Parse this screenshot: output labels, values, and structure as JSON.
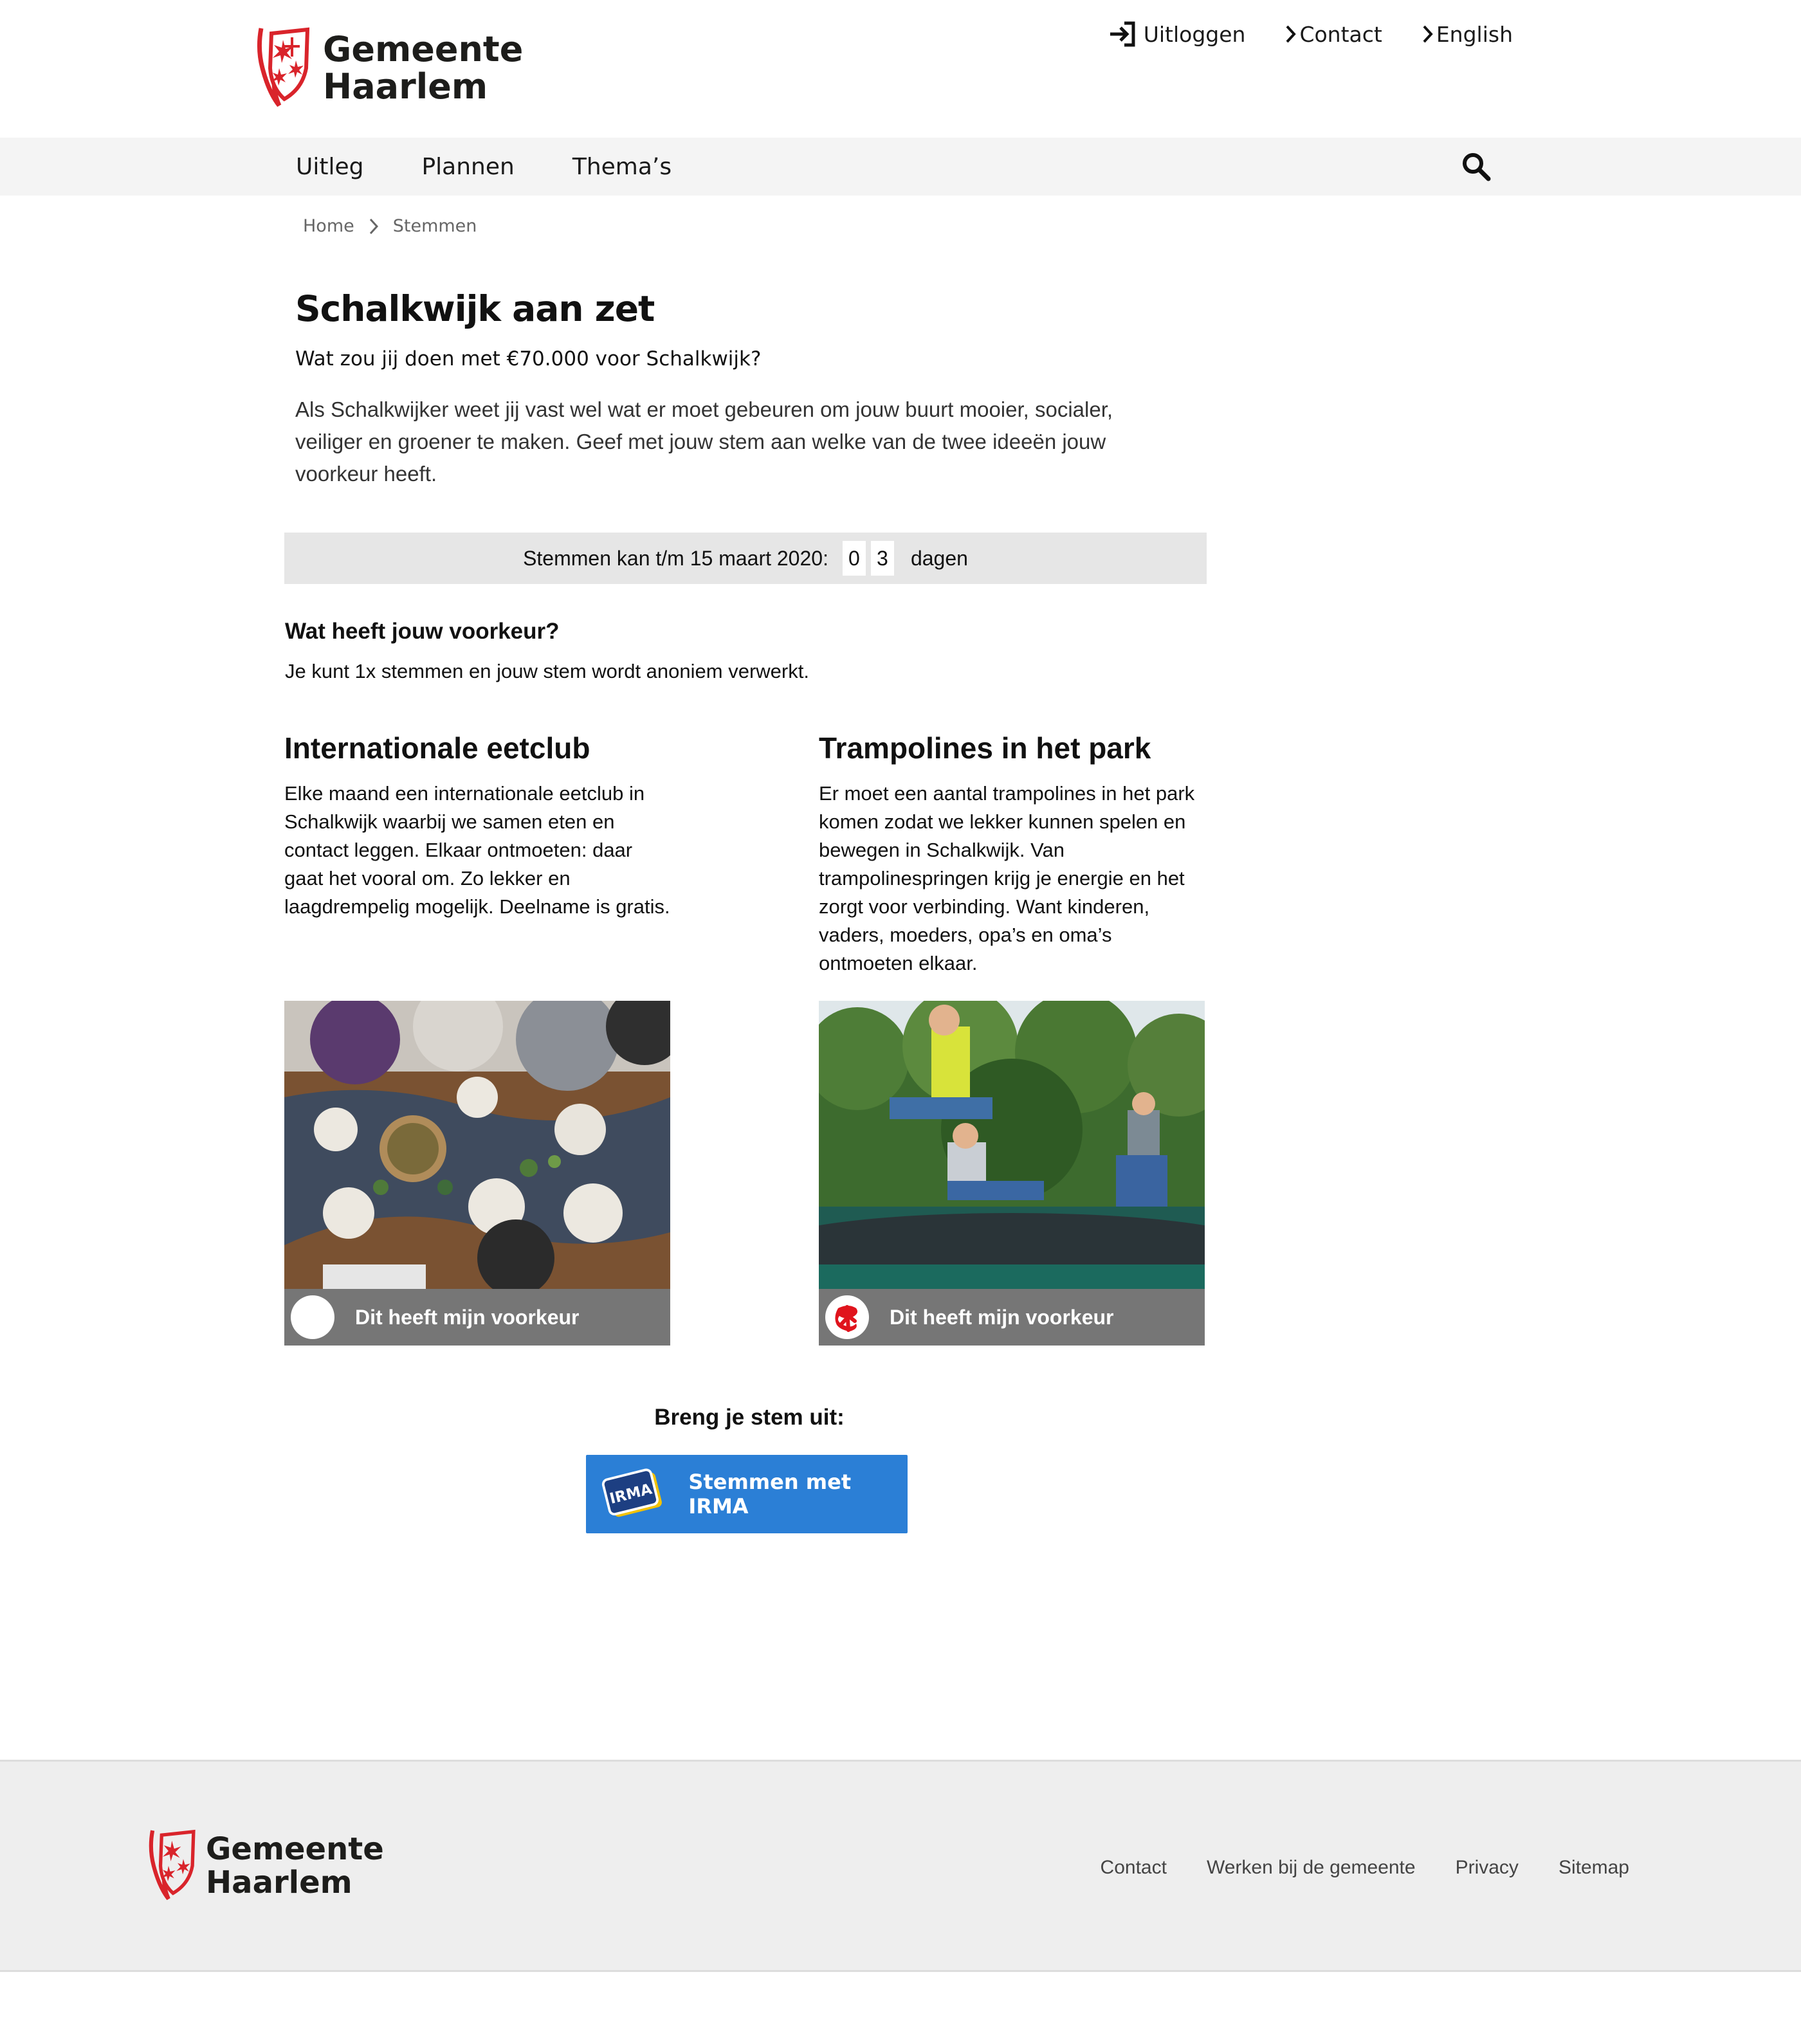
{
  "brand": {
    "line1": "Gemeente",
    "line2": "Haarlem",
    "red": "#d9242b"
  },
  "toplinks": {
    "logout": "Uitloggen",
    "contact": "Contact",
    "english": "English"
  },
  "nav": {
    "items": [
      "Uitleg",
      "Plannen",
      "Thema’s"
    ],
    "search_icon": "search-icon"
  },
  "breadcrumb": {
    "home": "Home",
    "current": "Stemmen"
  },
  "page": {
    "title": "Schalkwijk aan zet",
    "subtitle": "Wat zou jij doen met €70.000 voor Schalkwijk?",
    "intro": "Als Schalkwijker weet jij vast wel wat er moet gebeuren om jouw buurt mooier, socialer, veiliger en groener te maken. Geef met jouw stem aan welke van de twee ideeën jouw voorkeur heeft."
  },
  "countdown": {
    "label": "Stemmen kan t/m 15 maart 2020:",
    "digit1": "0",
    "digit2": "3",
    "unit": "dagen"
  },
  "question": {
    "heading": "Wat heeft jouw voorkeur?",
    "note": "Je kunt 1x stemmen en jouw stem wordt anoniem verwerkt."
  },
  "options": [
    {
      "title": "Internationale eetclub",
      "description": "Elke maand een internationale eetclub in Schalkwijk waarbij we samen eten en contact leggen. Elkaar ontmoeten: daar gaat het vooral om. Zo lekker en laagdrempelig mogelijk. Deelname is gratis.",
      "vote_label": "Dit heeft mijn voorkeur",
      "selected": false
    },
    {
      "title": "Trampolines in het park",
      "description": "Er moet een aantal trampolines in het park komen zodat we lekker kunnen spelen en bewegen in Schalkwijk. Van trampolinespringen krijg je energie en het zorgt voor verbinding. Want kinderen, vaders, moeders, opa’s en oma’s ontmoeten elkaar.",
      "vote_label": "Dit heeft mijn voorkeur",
      "selected": true
    }
  ],
  "cast": {
    "heading": "Breng je stem uit:",
    "button": "Stemmen met IRMA",
    "logo_text": "IRMA",
    "button_color": "#2b7fd6"
  },
  "footer": {
    "links": [
      "Contact",
      "Werken bij de gemeente",
      "Privacy",
      "Sitemap"
    ]
  }
}
